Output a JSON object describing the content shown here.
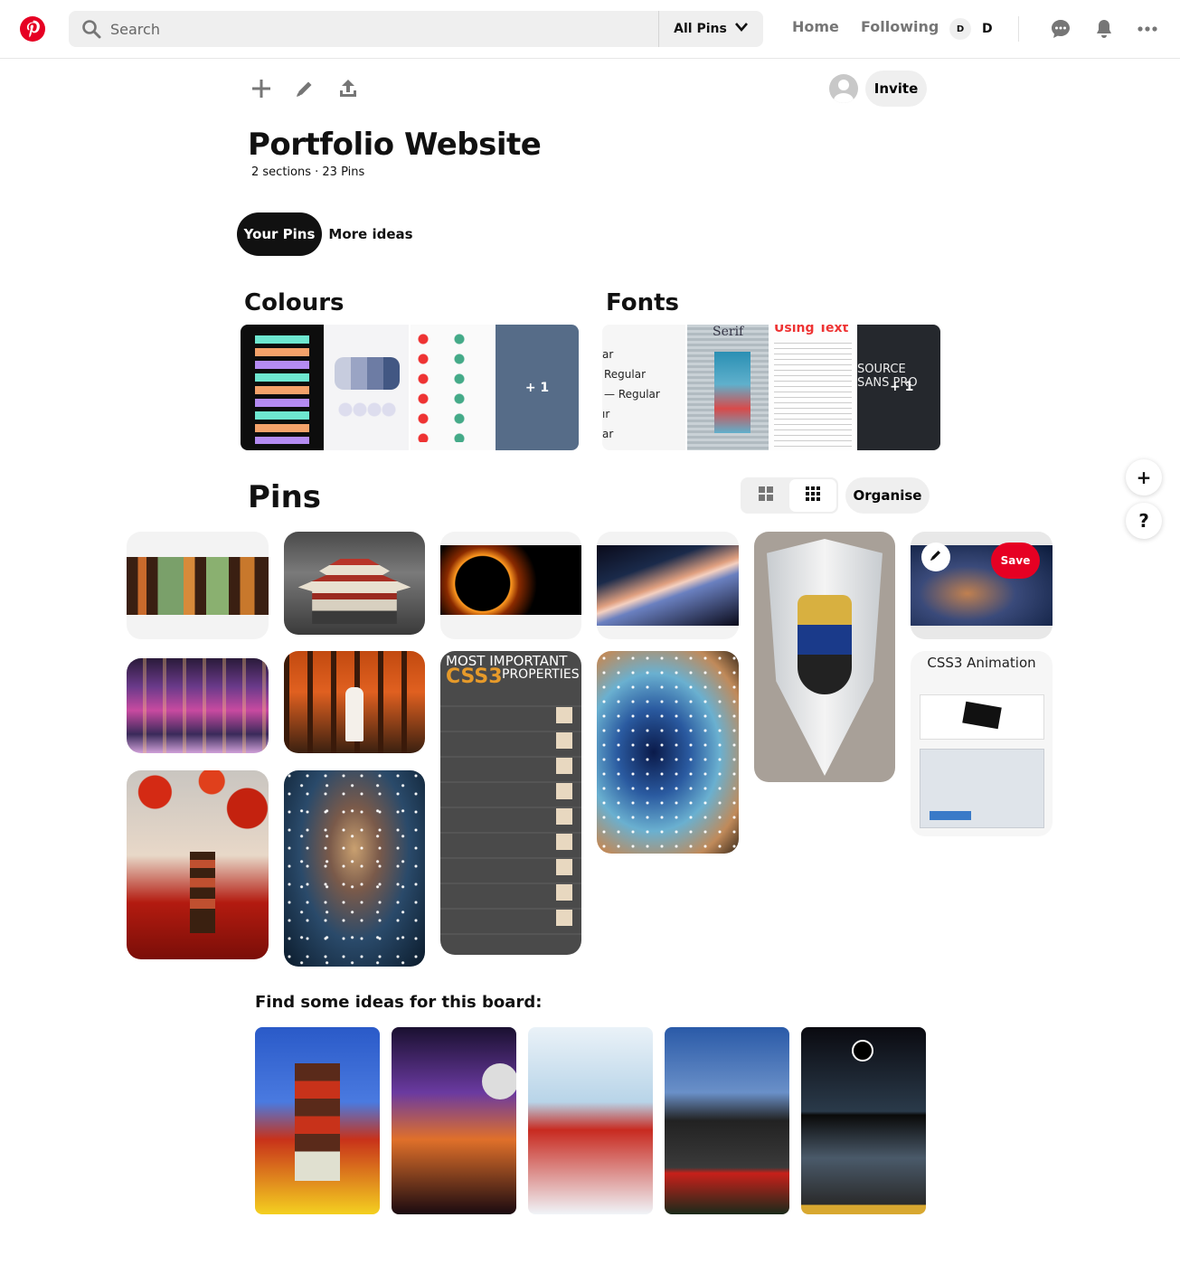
{
  "header": {
    "search_placeholder": "Search",
    "scope_label": "All Pins",
    "nav_home": "Home",
    "nav_following": "Following",
    "user_avatar_letter": "D",
    "user_initial": "D"
  },
  "board": {
    "invite_label": "Invite",
    "title": "Portfolio Website",
    "meta": "2 sections · 23 Pins",
    "tabs": [
      {
        "label": "Your Pins",
        "active": true
      },
      {
        "label": "More ideas",
        "active": false
      }
    ]
  },
  "sections": [
    {
      "title": "Colours",
      "more_label": "+ 1"
    },
    {
      "title": "Fonts",
      "more_label": "+ 1",
      "preview_text": [
        "ar",
        "Regular",
        "— Regular",
        "ır",
        "ar"
      ],
      "preview_serif": "Serif",
      "preview_using": "Using Text",
      "preview_sans": [
        "SOURCE",
        "SANS PRO"
      ]
    }
  ],
  "pins_section": {
    "title": "Pins",
    "organise_label": "Organise",
    "save_label": "Save",
    "css3_card_title": "CSS3 Animation",
    "css3_infographic": [
      "MOST IMPORTANT",
      "CSS3",
      "PROPERTIES"
    ]
  },
  "ideas": {
    "title": "Find some ideas for this board:"
  },
  "float": {
    "add_symbol": "+",
    "help_symbol": "?"
  },
  "colors": {
    "brand_red": "#e60023",
    "search_bg": "#efefef",
    "text_muted": "#767676"
  }
}
